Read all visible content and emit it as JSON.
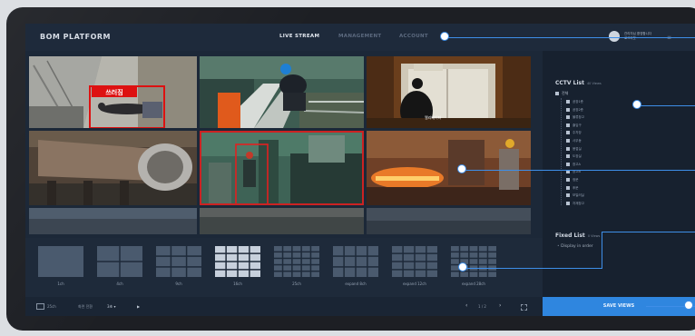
{
  "brand": "BOM PLATFORM",
  "nav": [
    {
      "label": "LIVE STREAM",
      "active": true
    },
    {
      "label": "MANAGEMENT",
      "active": false
    },
    {
      "label": "ACCOUNT",
      "active": false
    }
  ],
  "user": {
    "line1": "관리자님 환영합니다",
    "line2": "로그아웃"
  },
  "cameras": {
    "warning_label": "쓰러짐",
    "elevator_caption": "엘리베이터"
  },
  "cctv": {
    "title": "CCTV List",
    "count": "40 Views",
    "root": "전체",
    "items": [
      "공장1층",
      "공장2층",
      "물류창고",
      "출입구",
      "주차장",
      "사무동",
      "용접실",
      "도장실",
      "창고A",
      "창고B",
      "정문",
      "후문",
      "보일러실",
      "자재창고"
    ]
  },
  "fixed": {
    "title": "Fixed List",
    "count": "0 Views",
    "subtitle": "Display in order"
  },
  "layouts": [
    {
      "label": "1ch"
    },
    {
      "label": "4ch"
    },
    {
      "label": "9ch"
    },
    {
      "label": "16ch"
    },
    {
      "label": "25ch"
    },
    {
      "label": "expand 8ch"
    },
    {
      "label": "expand 12ch"
    },
    {
      "label": "expand 28ch"
    }
  ],
  "bottom": {
    "ch_label": "25ch",
    "interval_label": "화면 전환",
    "interval_value": "3초",
    "page": "1 / 2",
    "save_label": "SAVE VIEWS"
  },
  "colors": {
    "accent": "#2f86df",
    "highlight": "#cc2222"
  }
}
